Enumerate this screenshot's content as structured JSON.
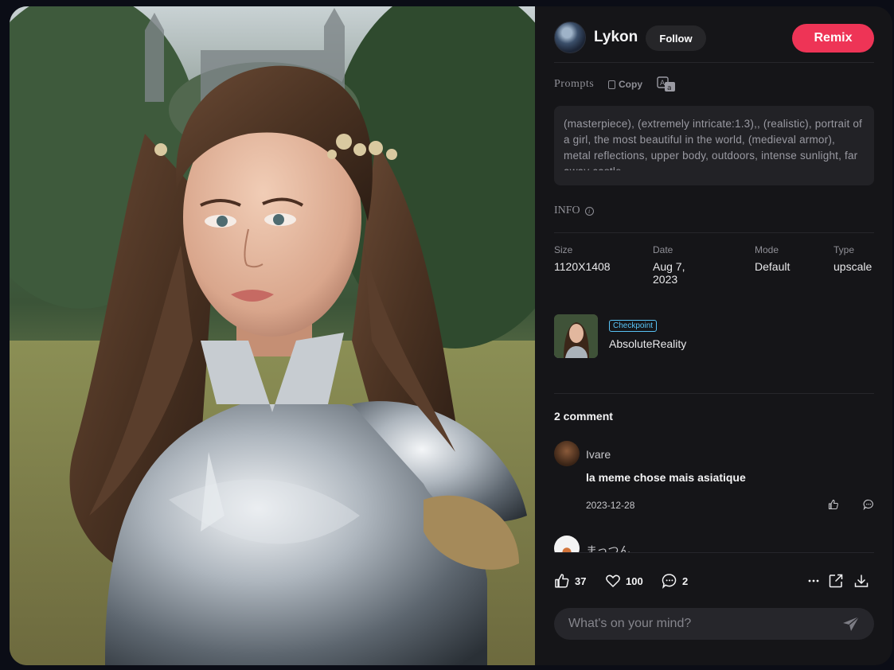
{
  "post": {
    "author": "Lykon",
    "follow_label": "Follow",
    "remix_label": "Remix"
  },
  "prompts": {
    "label": "Prompts",
    "copy_label": "Copy",
    "text": "(masterpiece), (extremely intricate:1.3),, (realistic), portrait of a girl, the most beautiful in the world, (medieval armor), metal reflections, upper body, outdoors, intense sunlight, far away castle,"
  },
  "info": {
    "label": "INFO",
    "fields": [
      {
        "key": "Size",
        "value": "1120X1408"
      },
      {
        "key": "Date",
        "value": "Aug 7, 2023"
      },
      {
        "key": "Mode",
        "value": "Default"
      },
      {
        "key": "Type",
        "value": "upscale"
      }
    ]
  },
  "checkpoint": {
    "badge": "Checkpoint",
    "name": "AbsoluteReality"
  },
  "comments": {
    "title": "2 comment",
    "items": [
      {
        "user": "Ivare",
        "text": "la meme chose mais asiatique",
        "date": "2023-12-28"
      },
      {
        "user": "まっつん",
        "text": "",
        "date": ""
      }
    ]
  },
  "actions": {
    "likes": "37",
    "favorites": "100",
    "comments": "2"
  },
  "composer": {
    "placeholder": "What's on your mind?"
  },
  "colors": {
    "accent": "#ee3456",
    "checkpoint_badge": "#58c3f5",
    "panel_bg": "#151518"
  },
  "icons": [
    "copy-icon",
    "translate-icon",
    "info-icon",
    "like-icon",
    "heart-icon",
    "comment-icon",
    "more-icon",
    "share-icon",
    "download-icon",
    "send-icon",
    "reply-icon"
  ]
}
